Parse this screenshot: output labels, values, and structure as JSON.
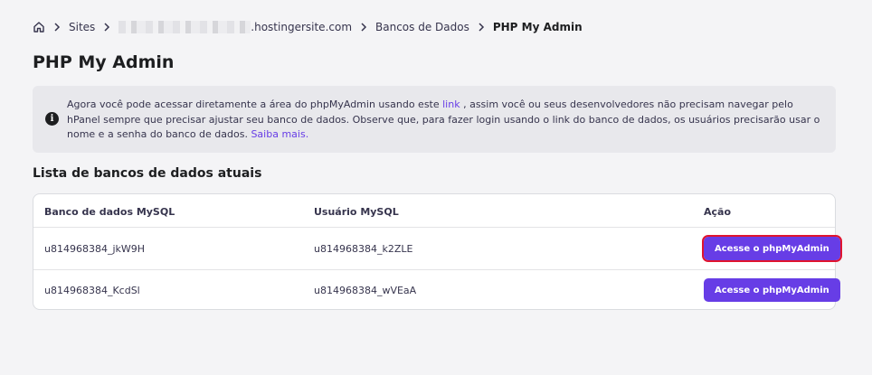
{
  "breadcrumb": {
    "home_icon": "home-icon",
    "sites_label": "Sites",
    "site_suffix": ".hostingersite.com",
    "databases_label": "Bancos de Dados",
    "current_label": "PHP My Admin"
  },
  "page": {
    "title": "PHP My Admin"
  },
  "info": {
    "icon": "info-icon",
    "text_before_link": "Agora você pode acessar diretamente a área do phpMyAdmin usando este ",
    "link_label": "link",
    "text_after_link": " , assim você ou seus desenvolvedores não precisam navegar pelo hPanel sempre que precisar ajustar seu banco de dados. Observe que, para fazer login usando o link do banco de dados, os usuários precisarão usar o nome e a senha do banco de dados. ",
    "learn_more_label": "Saiba mais."
  },
  "databases": {
    "section_title": "Lista de bancos de dados atuais",
    "columns": [
      "Banco de dados MySQL",
      "Usuário MySQL",
      "Ação"
    ],
    "rows": [
      {
        "database": "u814968384_jkW9H",
        "user": "u814968384_k2ZLE",
        "action_label": "Acesse o phpMyAdmin"
      },
      {
        "database": "u814968384_KcdSl",
        "user": "u814968384_wVEaA",
        "action_label": "Acesse o phpMyAdmin"
      }
    ]
  },
  "colors": {
    "accent": "#673de6",
    "highlight": "#e0142f",
    "background": "#f4f4f6"
  }
}
